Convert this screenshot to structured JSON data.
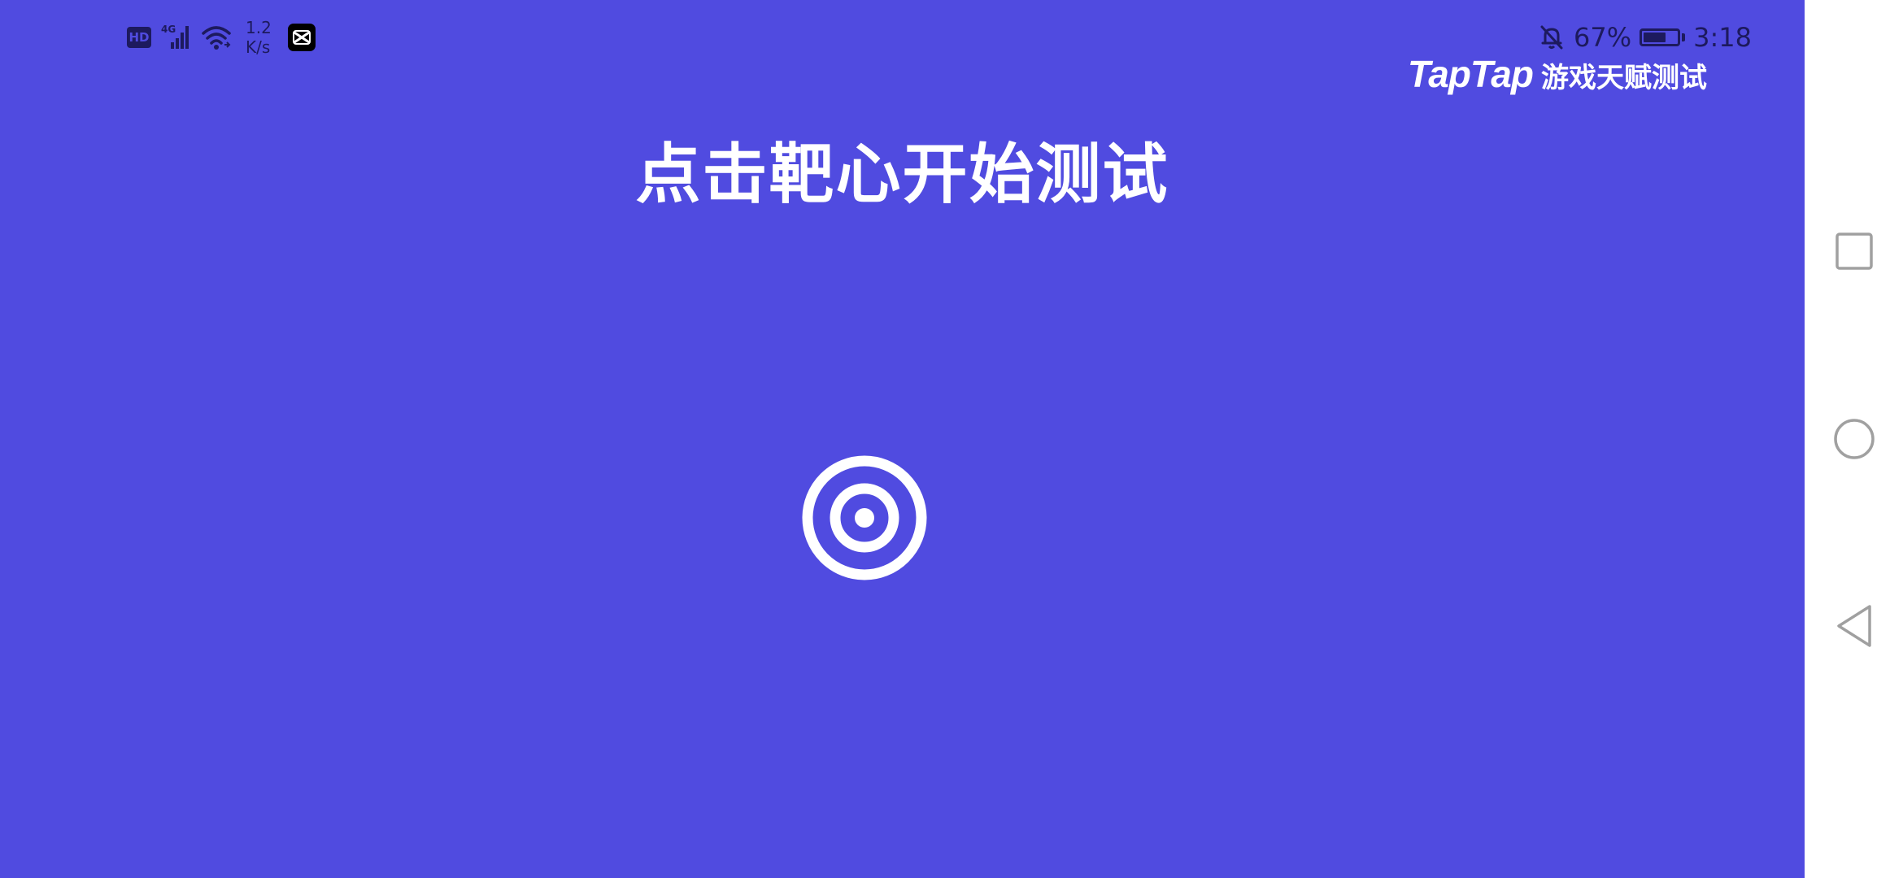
{
  "status_bar": {
    "hd": "HD",
    "network": "4G",
    "speed_value": "1.2",
    "speed_unit": "K/s",
    "battery": "67%",
    "time": "3:18"
  },
  "brand": {
    "logo": "TapTap",
    "subtitle": "游戏天赋测试"
  },
  "main": {
    "title": "点击靶心开始测试"
  },
  "colors": {
    "background": "#504be0",
    "text": "#ffffff",
    "status_icons": "#1d1a5e"
  },
  "nav": {
    "recents_icon": "square-icon",
    "home_icon": "circle-icon",
    "back_icon": "triangle-back-icon"
  }
}
